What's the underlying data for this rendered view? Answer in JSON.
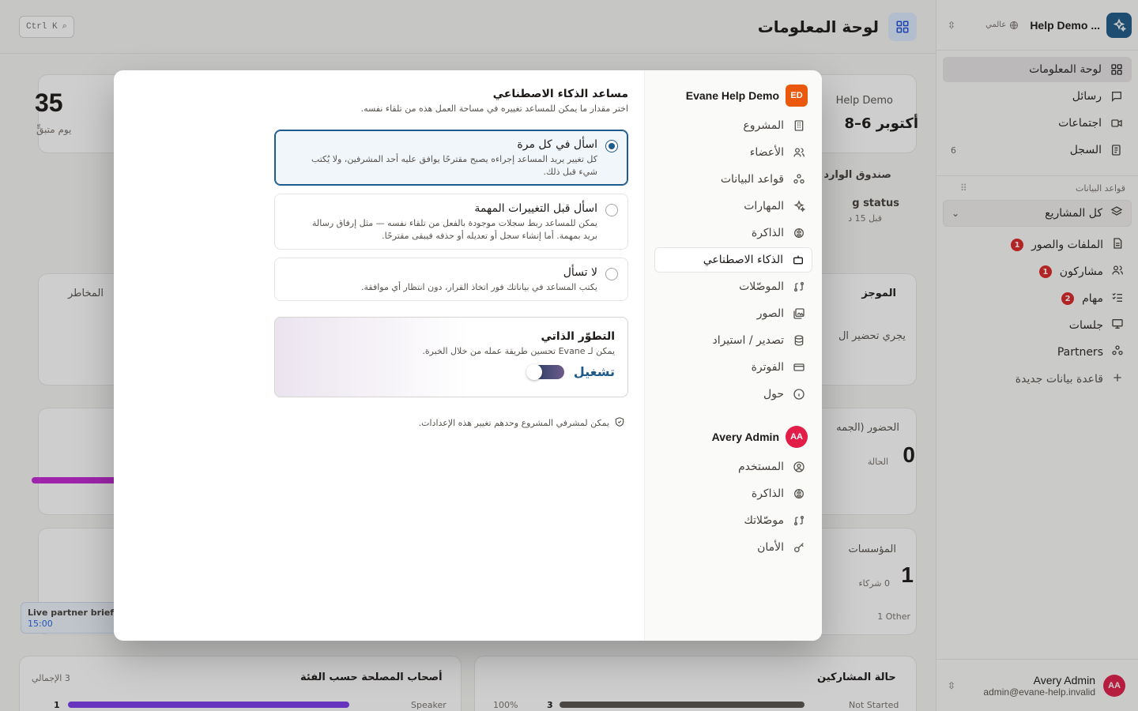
{
  "sidebar": {
    "workspace_name": "Help Demo ...",
    "workspace_scope": "عالمي",
    "nav": [
      {
        "label": "لوحة المعلومات"
      },
      {
        "label": "رسائل"
      },
      {
        "label": "اجتماعات"
      },
      {
        "label": "السجل",
        "count": "6"
      }
    ],
    "databases_label": "قواعد البيانات",
    "db_select": "كل المشاريع",
    "db_items": [
      {
        "label": "الملفات والصور",
        "badge": "1"
      },
      {
        "label": "مشاركون",
        "badge": "1"
      },
      {
        "label": "مهام",
        "badge": "2"
      },
      {
        "label": "جلسات"
      },
      {
        "label": "Partners"
      }
    ],
    "new_db": "قاعدة بيانات جديدة",
    "user": {
      "initials": "AA",
      "name": "Avery Admin",
      "email": "admin@evane-help.invalid"
    }
  },
  "main": {
    "title": "لوحة المعلومات",
    "shortcut": "Ctrl K",
    "bg": {
      "days_value": "35",
      "days_label": "يوم متبقٍّ",
      "event_name": "Help Demo",
      "event_dates": "أكتوبر 6–8",
      "inbox_label": "صندوق الوارد",
      "status_label": "g status",
      "status_time": "قبل 15 د",
      "risks_label": "المخاطر",
      "summary_label": "الموجز",
      "summary_text": "يجري تحضير ال",
      "attendance_label": "الحضور (الجمه",
      "attendance_value": "0",
      "attendance_sub": "الحالة",
      "orgs_label": "المؤسسات",
      "orgs_value": "1",
      "orgs_sub": "0 شركاء",
      "orgs_other": "1 Other",
      "live_event": "Live partner briefin",
      "live_time": "15:00",
      "stakeholders_label": "أصحاب المصلحة حسب الفئة",
      "stakeholders_total": "3 الإجمالي",
      "stake_row_value": "1",
      "stake_row_label": "Speaker",
      "participants_label": "حالة المشاركين",
      "part_pct": "100%",
      "part_value": "3",
      "part_label": "Not Started"
    }
  },
  "modal": {
    "nav_head": {
      "initials": "ED",
      "title": "Evane Help Demo"
    },
    "nav_items": [
      {
        "label": "المشروع"
      },
      {
        "label": "الأعضاء"
      },
      {
        "label": "قواعد البيانات"
      },
      {
        "label": "المهارات"
      },
      {
        "label": "الذاكرة"
      },
      {
        "label": "الذكاء الاصطناعي"
      },
      {
        "label": "الموصّلات"
      },
      {
        "label": "الصور"
      },
      {
        "label": "تصدير / استيراد"
      },
      {
        "label": "الفوترة"
      },
      {
        "label": "حول"
      }
    ],
    "user_head": {
      "initials": "AA",
      "name": "Avery Admin"
    },
    "user_items": [
      {
        "label": "المستخدم"
      },
      {
        "label": "الذاكرة"
      },
      {
        "label": "موصّلاتك"
      },
      {
        "label": "الأمان"
      }
    ],
    "title": "مساعد الذكاء الاصطناعي",
    "subtitle": "اختر مقدار ما يمكن للمساعد تغييره في مساحة العمل هذه من تلقاء نفسه.",
    "options": [
      {
        "title": "اسأل في كل مرة",
        "desc": "كل تغيير يريد المساعد إجراءه يصبح مقترحًا يوافق عليه أحد المشرفين، ولا يُكتب شيء قبل ذلك.",
        "selected": true
      },
      {
        "title": "اسأل قبل التغييرات المهمة",
        "desc": "يمكن للمساعد ربط سجلات موجودة بالفعل من تلقاء نفسه — مثل إرفاق رسالة بريد بمهمة. أما إنشاء سجل أو تعديله أو حذفه فيبقى مقترحًا."
      },
      {
        "title": "لا تسأل",
        "desc": "يكتب المساعد في بياناتك فور اتخاذ القرار، دون انتظار أي موافقة."
      }
    ],
    "evolution": {
      "title": "التطوّر الذاتي",
      "desc": "يمكن لـ Evane تحسين طريقة عمله من خلال الخبرة.",
      "toggle_label": "تشغيل"
    },
    "note": "يمكن لمشرفي المشروع وحدهم تغيير هذه الإعدادات."
  },
  "colors": {
    "accent": "#1e5a8a",
    "danger": "#dc2626",
    "avatar": "#e11d48",
    "workspace_logo": "#ea580c"
  }
}
